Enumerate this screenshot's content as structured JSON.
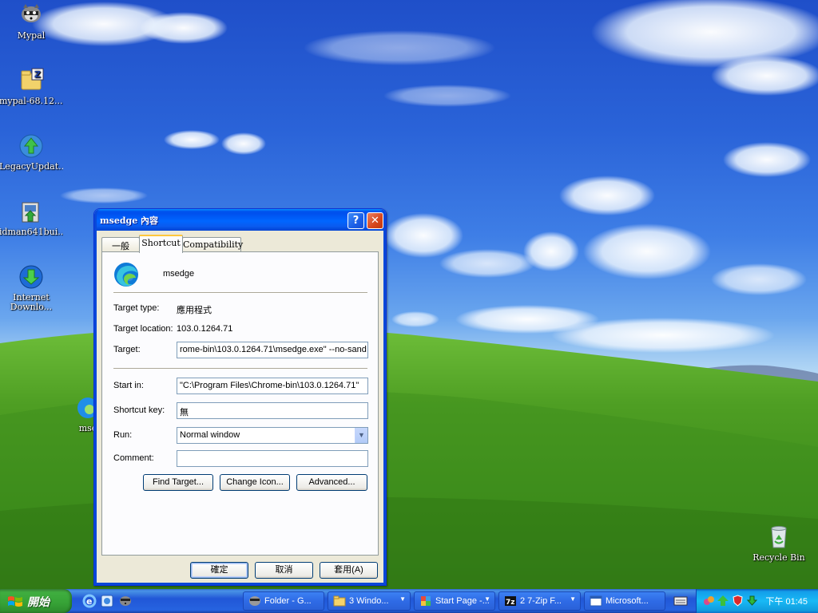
{
  "desktop": {
    "icons": [
      {
        "label": "Mypal",
        "icon": "raccoon-icon"
      },
      {
        "label": "mypal-68.12....",
        "icon": "zip-archive-icon"
      },
      {
        "label": "LegacyUpdat...",
        "icon": "update-globe-icon"
      },
      {
        "label": "idman641bui...",
        "icon": "installer-icon"
      },
      {
        "label": "Internet Downlo...",
        "icon": "download-manager-icon"
      },
      {
        "label": "mse",
        "icon": "edge-icon"
      },
      {
        "label": "Recycle Bin",
        "icon": "recycle-bin-icon"
      }
    ]
  },
  "dialog": {
    "title": "msedge 內容",
    "help_glyph": "?",
    "close_glyph": "✕",
    "tabs": [
      {
        "label": "一般",
        "active": false
      },
      {
        "label": "Shortcut",
        "active": true
      },
      {
        "label": "Compatibility",
        "active": false
      }
    ],
    "app_name": "msedge",
    "target_type_label": "Target type:",
    "target_type_value": "應用程式",
    "target_location_label": "Target location:",
    "target_location_value": "103.0.1264.71",
    "target_label": "Target:",
    "target_value": "rome-bin\\103.0.1264.71\\msedge.exe\" --no-sand",
    "start_in_label": "Start in:",
    "start_in_value": "\"C:\\Program Files\\Chrome-bin\\103.0.1264.71\"",
    "shortcut_key_label": "Shortcut key:",
    "shortcut_key_value": "無",
    "run_label": "Run:",
    "run_value": "Normal window",
    "comment_label": "Comment:",
    "comment_value": "",
    "buttons": {
      "find_target": "Find Target...",
      "change_icon": "Change Icon...",
      "advanced": "Advanced...",
      "ok": "確定",
      "cancel": "取消",
      "apply": "套用(A)"
    }
  },
  "taskbar": {
    "start_label": "開始",
    "tasks": [
      {
        "label": "Folder - G...",
        "icon": "raccoon-icon",
        "grouped": false
      },
      {
        "label": "3 Windo...",
        "icon": "folder-icon",
        "grouped": true
      },
      {
        "label": "Start Page -...",
        "icon": "puzzle-icon",
        "grouped": true
      },
      {
        "label": "2 7-Zip F...",
        "icon": "7zip-icon",
        "grouped": true
      },
      {
        "label": "Microsoft...",
        "icon": "window-icon",
        "grouped": false
      }
    ],
    "clock": "下午 01:45"
  },
  "colors": {
    "titlebar": "#0054e3",
    "taskbar": "#245edb",
    "start_green": "#3c9a3c",
    "tray": "#0f9ddf",
    "window_bg": "#ece9d8"
  }
}
